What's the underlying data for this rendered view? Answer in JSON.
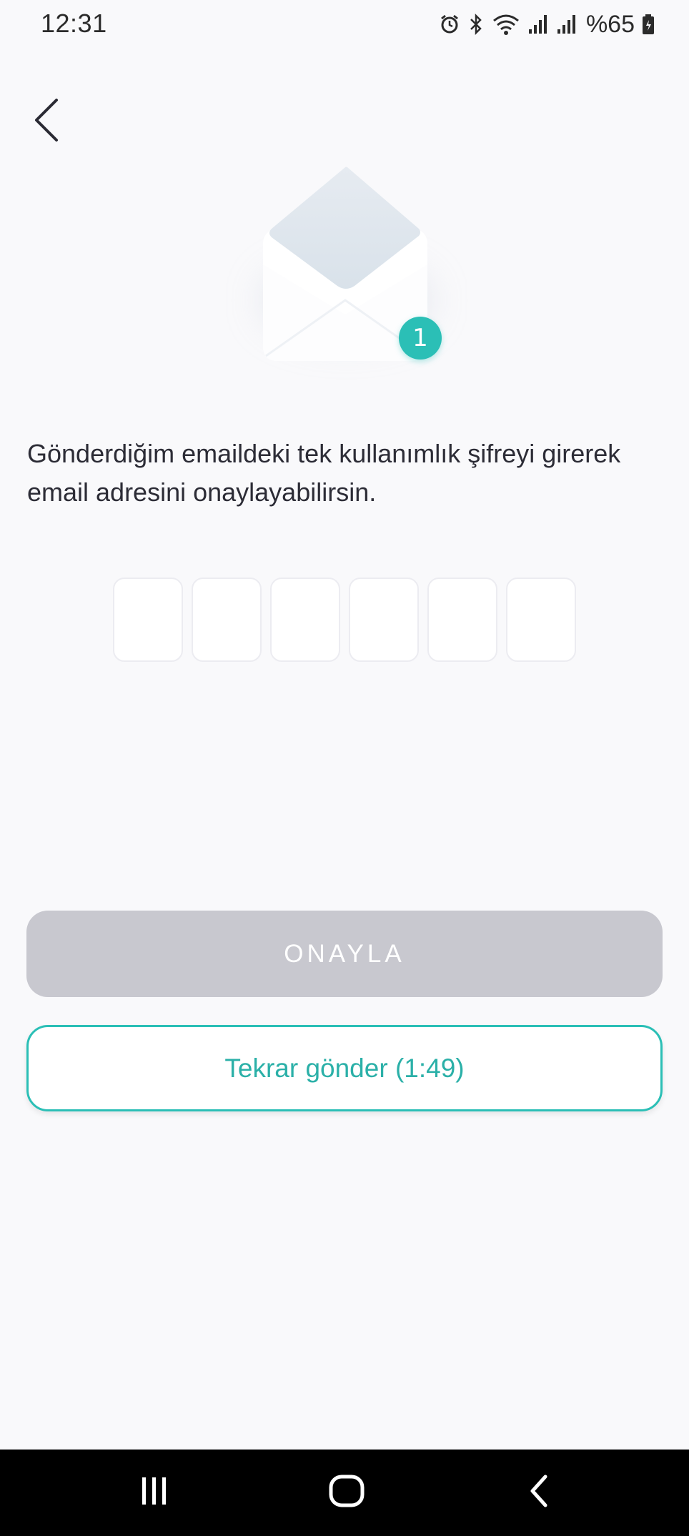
{
  "status_bar": {
    "time": "12:31",
    "battery": "%65",
    "icons": [
      "alarm-icon",
      "bluetooth-icon",
      "wifi-icon",
      "signal-icon",
      "signal-icon",
      "battery-icon"
    ]
  },
  "header": {
    "back_icon": "chevron-left-icon"
  },
  "illustration": {
    "icon": "envelope-open-icon",
    "badge_count": "1",
    "accent": "#2bbfb6"
  },
  "main": {
    "description": "Gönderdiğim emaildeki tek kullanımlık şifreyi girerek email adresini onaylayabilirsin.",
    "otp_boxes": [
      "",
      "",
      "",
      "",
      "",
      ""
    ]
  },
  "actions": {
    "confirm_label": "ONAYLA",
    "confirm_color": "#c8c8cf",
    "resend_label": "Tekrar gönder (1:49)",
    "resend_color": "#2bbfb6"
  },
  "nav_bar": {
    "icons": [
      "recent-apps-icon",
      "home-icon",
      "back-icon"
    ]
  }
}
